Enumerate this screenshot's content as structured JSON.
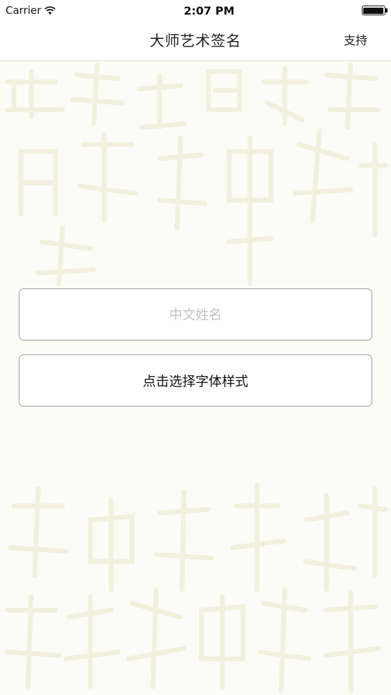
{
  "status_bar": {
    "carrier": "Carrier",
    "time": "2:07 PM",
    "icons": [
      "wifi-icon",
      "battery-icon"
    ]
  },
  "nav": {
    "title": "大师艺术签名",
    "right_button": "支持"
  },
  "form": {
    "name_input": {
      "value": "",
      "placeholder": "中文姓名"
    },
    "style_button": "点击选择字体样式"
  },
  "colors": {
    "background": "#fcfcf7",
    "watermark": "#efedd8",
    "field_border": "#9a9a9a",
    "placeholder": "#c2c2c2"
  }
}
